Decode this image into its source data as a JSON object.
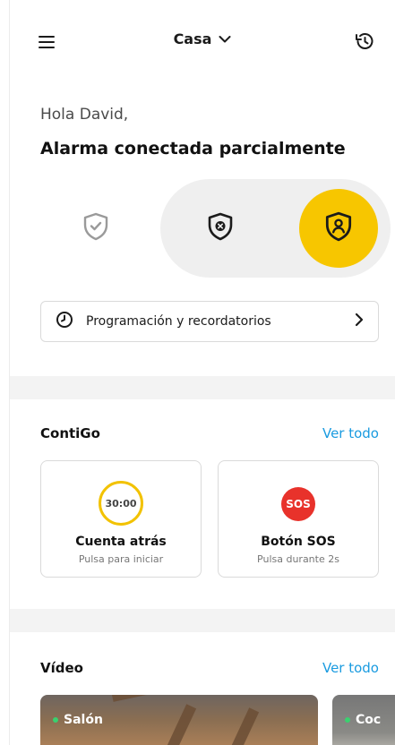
{
  "header": {
    "title": "Casa",
    "menu_icon": "hamburger-menu-icon",
    "history_icon": "history-icon"
  },
  "greeting": {
    "hello": "Hola David,",
    "status": "Alarma conectada parcialmente"
  },
  "modes": {
    "selected": "on",
    "accent": "#f7c600",
    "items": [
      "shield-check-icon",
      "shield-x-icon",
      "shield-person-icon"
    ]
  },
  "schedule": {
    "label": "Programación y recordatorios"
  },
  "contigo": {
    "title": "ContiGo",
    "link": "Ver todo",
    "countdown": {
      "time": "30:00",
      "title": "Cuenta atrás",
      "subtitle": "Pulsa para iniciar"
    },
    "sos": {
      "badge": "SOS",
      "title": "Botón SOS",
      "subtitle": "Pulsa durante 2s"
    }
  },
  "video": {
    "title": "Vídeo",
    "link": "Ver todo",
    "cameras": [
      {
        "name": "Salón",
        "status_color": "#39d16f"
      },
      {
        "name": "Coc",
        "status_color": "#39d16f"
      }
    ]
  },
  "colors": {
    "link": "#1a9be0",
    "accent": "#f7c600",
    "sos": "#e8322b"
  }
}
